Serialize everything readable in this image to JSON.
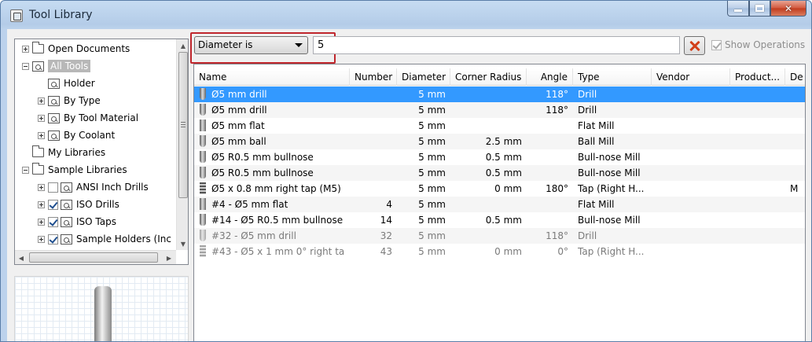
{
  "window": {
    "title": "Tool Library"
  },
  "tree": [
    {
      "label": "Open Documents",
      "icon": "folder-open-icon",
      "indent": 0,
      "expander": "plus"
    },
    {
      "label": "All Tools",
      "icon": "library-icon",
      "indent": 0,
      "expander": "minus",
      "selected": true
    },
    {
      "label": "Holder",
      "icon": "library-icon",
      "indent": 1,
      "expander": "none"
    },
    {
      "label": "By Type",
      "icon": "library-icon",
      "indent": 1,
      "expander": "plus"
    },
    {
      "label": "By Tool Material",
      "icon": "library-icon",
      "indent": 1,
      "expander": "plus"
    },
    {
      "label": "By Coolant",
      "icon": "library-icon",
      "indent": 1,
      "expander": "plus"
    },
    {
      "label": "My Libraries",
      "icon": "folder-icon",
      "indent": 0,
      "expander": "none"
    },
    {
      "label": "Sample Libraries",
      "icon": "folder-icon",
      "indent": 0,
      "expander": "minus"
    },
    {
      "label": "ANSI Inch Drills",
      "icon": "library-icon",
      "indent": 1,
      "expander": "plus",
      "checkbox": false
    },
    {
      "label": "ISO Drills",
      "icon": "library-icon",
      "indent": 1,
      "expander": "plus",
      "checkbox": true
    },
    {
      "label": "ISO Taps",
      "icon": "library-icon",
      "indent": 1,
      "expander": "plus",
      "checkbox": true
    },
    {
      "label": "Sample Holders (Inc",
      "icon": "library-icon",
      "indent": 1,
      "expander": "plus",
      "checkbox": true
    }
  ],
  "filter": {
    "criterion": "Diameter is",
    "value": "5",
    "show_operations_label": "Show Operations",
    "show_operations_checked": true
  },
  "table": {
    "columns": [
      {
        "key": "name",
        "label": "Name"
      },
      {
        "key": "number",
        "label": "Number"
      },
      {
        "key": "diameter",
        "label": "Diameter"
      },
      {
        "key": "corner_radius",
        "label": "Corner Radius"
      },
      {
        "key": "angle",
        "label": "Angle"
      },
      {
        "key": "type",
        "label": "Type"
      },
      {
        "key": "vendor",
        "label": "Vendor"
      },
      {
        "key": "product",
        "label": "Product..."
      },
      {
        "key": "de",
        "label": "De"
      }
    ],
    "rows": [
      {
        "icon": "drill-icon",
        "name": "Ø5 mm drill",
        "number": "",
        "diameter": "5 mm",
        "corner_radius": "",
        "angle": "118°",
        "type": "Drill",
        "vendor": "",
        "product": "",
        "de": "",
        "selected": true
      },
      {
        "icon": "drill-icon",
        "name": "Ø5 mm drill",
        "number": "",
        "diameter": "5 mm",
        "corner_radius": "",
        "angle": "118°",
        "type": "Drill",
        "vendor": "",
        "product": "",
        "de": ""
      },
      {
        "icon": "flat-mill-icon",
        "name": "Ø5 mm flat",
        "number": "",
        "diameter": "5 mm",
        "corner_radius": "",
        "angle": "",
        "type": "Flat Mill",
        "vendor": "",
        "product": "",
        "de": ""
      },
      {
        "icon": "ball-mill-icon",
        "name": "Ø5 mm ball",
        "number": "",
        "diameter": "5 mm",
        "corner_radius": "2.5 mm",
        "angle": "",
        "type": "Ball Mill",
        "vendor": "",
        "product": "",
        "de": ""
      },
      {
        "icon": "bullnose-mill-icon",
        "name": "Ø5 R0.5 mm bullnose",
        "number": "",
        "diameter": "5 mm",
        "corner_radius": "0.5 mm",
        "angle": "",
        "type": "Bull-nose Mill",
        "vendor": "",
        "product": "",
        "de": ""
      },
      {
        "icon": "bullnose-mill-icon",
        "name": "Ø5 R0.5 mm bullnose",
        "number": "",
        "diameter": "5 mm",
        "corner_radius": "0.5 mm",
        "angle": "",
        "type": "Bull-nose Mill",
        "vendor": "",
        "product": "",
        "de": ""
      },
      {
        "icon": "tap-icon",
        "name": "Ø5 x 0.8 mm right tap (M5)",
        "number": "",
        "diameter": "5 mm",
        "corner_radius": "0 mm",
        "angle": "180°",
        "type": "Tap (Right H...",
        "vendor": "",
        "product": "",
        "de": "M"
      },
      {
        "icon": "flat-mill-icon",
        "name": "#4 - Ø5 mm flat",
        "number": "4",
        "diameter": "5 mm",
        "corner_radius": "",
        "angle": "",
        "type": "Flat Mill",
        "vendor": "",
        "product": "",
        "de": ""
      },
      {
        "icon": "bullnose-mill-icon",
        "name": "#14 - Ø5 R0.5 mm bullnose",
        "number": "14",
        "diameter": "5 mm",
        "corner_radius": "0.5 mm",
        "angle": "",
        "type": "Bull-nose Mill",
        "vendor": "",
        "product": "",
        "de": ""
      },
      {
        "icon": "drill-icon",
        "name": "#32 - Ø5 mm drill",
        "number": "32",
        "diameter": "5 mm",
        "corner_radius": "",
        "angle": "118°",
        "type": "Drill",
        "vendor": "",
        "product": "",
        "de": "",
        "dim": true
      },
      {
        "icon": "tap-icon",
        "name": "#43 - Ø5 x 1 mm 0° right tap",
        "number": "43",
        "diameter": "5 mm",
        "corner_radius": "0 mm",
        "angle": "0°",
        "type": "Tap (Right H...",
        "vendor": "",
        "product": "",
        "de": "",
        "dim": true
      }
    ]
  },
  "colors": {
    "selection": "#3399ff",
    "filter_highlight": "#c0272d",
    "clear_icon": "#d2401a"
  }
}
